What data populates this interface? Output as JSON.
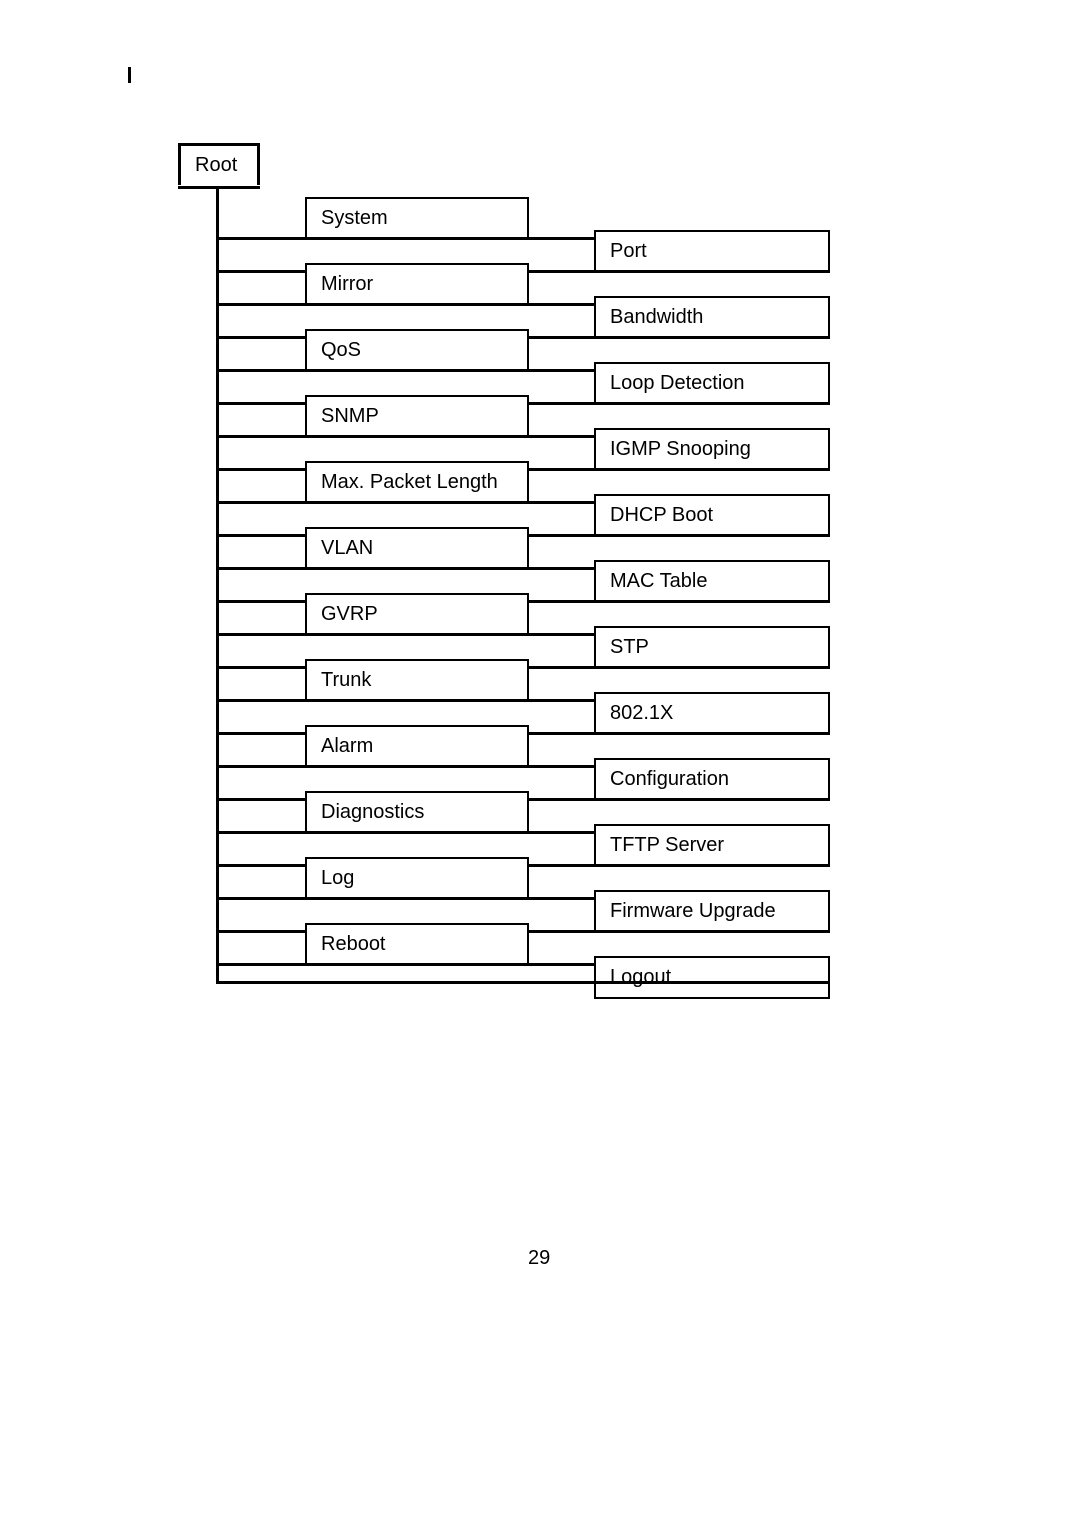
{
  "page_number": "29",
  "tree": {
    "root": "Root",
    "left_column": [
      "System",
      "Mirror",
      "QoS",
      "SNMP",
      "Max. Packet Length",
      "VLAN",
      "GVRP",
      "Trunk",
      "Alarm",
      "Diagnostics",
      "Log",
      "Reboot"
    ],
    "right_column": [
      "Port",
      "Bandwidth",
      "Loop Detection",
      "IGMP Snooping",
      "DHCP Boot",
      "MAC Table",
      "STP",
      "802.1X",
      "Configuration",
      "TFTP Server",
      "Firmware  Upgrade",
      "Logout"
    ]
  }
}
